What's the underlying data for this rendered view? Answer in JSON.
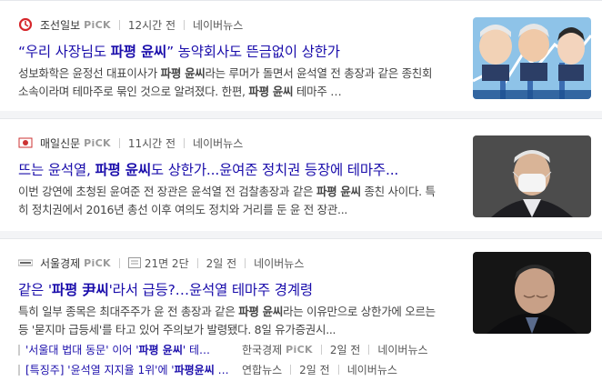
{
  "articles": [
    {
      "press": "조선일보",
      "pick": "PiCK",
      "time": "12시간 전",
      "source": "네이버뉴스",
      "title_pre": "“우리 사장님도 ",
      "title_hl": "파평 윤씨",
      "title_post": "” 농약회사도 뜬금없이 상한가",
      "desc_parts": [
        "성보화학은 윤정선 대표이사가 ",
        "파평 윤씨",
        "라는 루머가 돌면서 윤석열 전 총장과 같은 종친회 소속이라며 테마주로 묶인 것으로 알려졌다. 한편, ",
        "파평 윤씨",
        " 테마주 …"
      ],
      "thumb": "caricature-stock-chart"
    },
    {
      "press": "매일신문",
      "pick": "PiCK",
      "time": "11시간 전",
      "source": "네이버뉴스",
      "title_pre": "뜨는 윤석열, ",
      "title_hl": "파평 윤씨",
      "title_post": "도 상한가...윤여준 정치권 등장에 테마주...",
      "desc_parts": [
        "이번 강연에 초청된 윤여준 전 장관은 윤석열 전 검찰총장과 같은 ",
        "파평 윤씨",
        " 종친 사이다. 특히 정치권에서 2016년 총선 이후 여의도 정치와 거리를 둔 윤 전 장관..."
      ],
      "thumb": "man-with-mask"
    },
    {
      "press": "서울경제",
      "pick": "PiCK",
      "paper": "21면 2단",
      "time": "2일 전",
      "source": "네이버뉴스",
      "title_pre": "같은 '",
      "title_hl": "파평 尹씨",
      "title_post": "'라서 급등?…윤석열 테마주 경계령",
      "desc_parts": [
        "특히 일부 종목은 최대주주가 윤 전 총장과 같은 ",
        "파평 윤씨",
        "라는 이유만으로 상한가에 오르는 등 '묻지마 급등세'를 타고 있어 주의보가 발령됐다. 8일 유가증권시..."
      ],
      "thumb": "man-looking-down",
      "related": [
        {
          "pre": "'서울대 법대 동문' 이어 '",
          "hl": "파평 윤씨",
          "post": "' 테…",
          "press": "한국경제",
          "pick": "PiCK",
          "time": "2일 전",
          "source": "네이버뉴스"
        },
        {
          "pre": "[특징주] '윤석열 지지율 1위'에 '",
          "hl": "파평윤씨",
          "post": " 테...",
          "press": "연합뉴스",
          "pick": "",
          "time": "2일 전",
          "source": "네이버뉴스"
        }
      ]
    }
  ]
}
